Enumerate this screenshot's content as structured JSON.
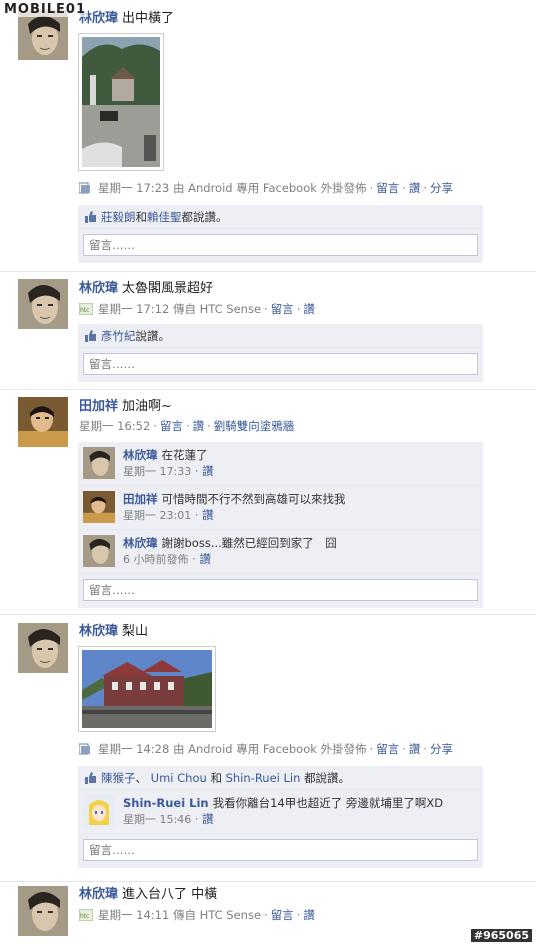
{
  "watermark": "MOBILE01",
  "image_id_badge": "#965065",
  "icons": {
    "android": "post-source-icon",
    "htc": "htc-icon",
    "like": "thumbs-up-icon"
  },
  "comment_placeholder": "留言……",
  "posts": [
    {
      "name": "林欣瑋",
      "message": "出中橫了",
      "time": "星期一 17:23",
      "via": "由 Android 專用 Facebook 外掛發佈",
      "actions": [
        "留言",
        "讚",
        "分享"
      ],
      "likes": {
        "names": [
          "莊毅朗",
          "賴佳聖"
        ],
        "joiner": "和",
        "suffix": "都說讚。"
      }
    },
    {
      "name": "林欣瑋",
      "message": "太魯閣風景超好",
      "time": "星期一 17:12",
      "via": "傳自 HTC Sense",
      "actions": [
        "留言",
        "讚"
      ],
      "likes": {
        "names": [
          "彥竹紀"
        ],
        "suffix": "說讚。"
      }
    },
    {
      "name": "田加祥",
      "message": "加油啊~",
      "time": "星期一 16:52",
      "actions": [
        "留言",
        "讚",
        "劉騎雙向塗鴉牆"
      ],
      "comments": [
        {
          "name": "林欣瑋",
          "text": "在花蓮了",
          "time": "星期一 17:33",
          "action": "讚"
        },
        {
          "name": "田加祥",
          "text": "可惜時間不行不然到高雄可以來找我",
          "time": "星期一 23:01",
          "action": "讚"
        },
        {
          "name": "林欣瑋",
          "text": "謝謝boss...雖然已經回到家了　囧",
          "time": "6 小時前發佈",
          "action": "讚"
        }
      ]
    },
    {
      "name": "林欣瑋",
      "message": "梨山",
      "time": "星期一 14:28",
      "via": "由 Android 專用 Facebook 外掛發佈",
      "actions": [
        "留言",
        "讚",
        "分享"
      ],
      "likes": {
        "names": [
          "陳猴子",
          "Umi Chou",
          "Shin-Ruei Lin"
        ],
        "sep": "、",
        "joiner": "和",
        "suffix": "都說讚。"
      },
      "comments": [
        {
          "name": "Shin-Ruei Lin",
          "text": "我看你離台14甲也超近了 旁邊就埔里了啊XD",
          "time": "星期一 15:46",
          "action": "讚"
        }
      ]
    },
    {
      "name": "林欣瑋",
      "message": "進入台八了 中橫",
      "time": "星期一 14:11",
      "via": "傳自 HTC Sense",
      "actions": [
        "留言",
        "讚"
      ]
    }
  ]
}
